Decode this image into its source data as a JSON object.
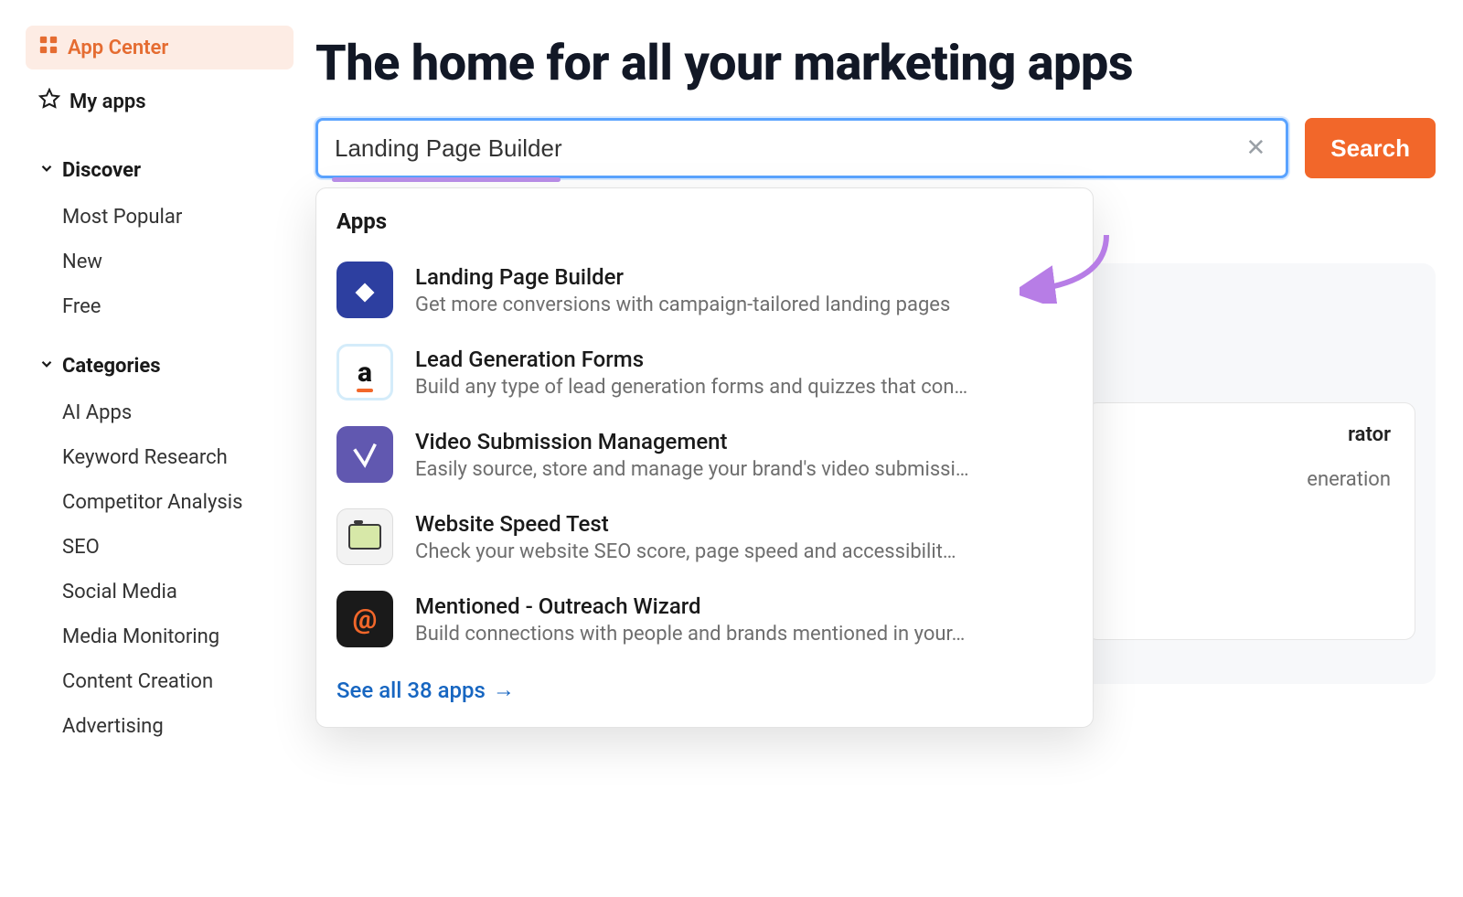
{
  "sidebar": {
    "app_center": "App Center",
    "my_apps": "My apps",
    "discover_label": "Discover",
    "discover": [
      "Most Popular",
      "New",
      "Free"
    ],
    "categories_label": "Categories",
    "categories": [
      "AI Apps",
      "Keyword Research",
      "Competitor Analysis",
      "SEO",
      "Social Media",
      "Media Monitoring",
      "Content Creation",
      "Advertising"
    ]
  },
  "page": {
    "title": "The home for all your marketing apps",
    "peek_title": "rator",
    "peek_sub": "eneration"
  },
  "search": {
    "value": "Landing Page Builder",
    "button": "Search"
  },
  "dropdown": {
    "heading": "Apps",
    "see_all": "See all 38 apps",
    "results": [
      {
        "title": "Landing Page Builder",
        "desc": "Get more conversions with campaign-tailored landing pages"
      },
      {
        "title": "Lead Generation Forms",
        "desc": "Build any type of lead generation forms and quizzes that con…"
      },
      {
        "title": "Video Submission Management",
        "desc": "Easily source, store and manage your brand's video submissi…"
      },
      {
        "title": "Website Speed Test",
        "desc": "Check your website SEO score, page speed and accessibilit…"
      },
      {
        "title": "Mentioned - Outreach Wizard",
        "desc": "Build connections with people and brands mentioned in your…"
      }
    ]
  }
}
